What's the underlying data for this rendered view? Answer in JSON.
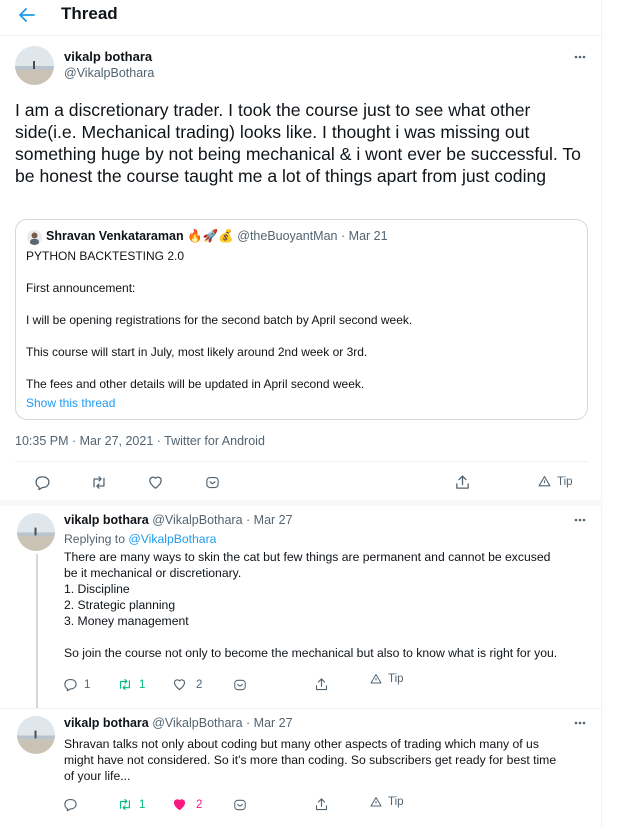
{
  "header": {
    "title": "Thread"
  },
  "main_tweet": {
    "author_name": "vikalp bothara",
    "author_handle": "@VikalpBothara",
    "text": "I am a discretionary trader. I took the course just to see what other side(i.e. Mechanical trading) looks like. I thought i was missing out something huge by not being mechanical & i wont ever be successful. To be honest the course taught me a lot of things apart from just coding",
    "quoted": {
      "author_name": "Shravan Venkataraman",
      "emojis": "🔥🚀💰",
      "handle": "@theBuoyantMan",
      "separator": "·",
      "date": "Mar 21",
      "lines": [
        "PYTHON BACKTESTING 2.0",
        "First announcement:",
        "I will be opening registrations for the second batch by April second week.",
        "This course will start in July, most likely around 2nd week or 3rd.",
        "The fees and other details will be updated in April second week."
      ],
      "show_thread": "Show this thread"
    },
    "meta": "10:35 PM · Mar 27, 2021 · Twitter for Android",
    "tip_label": "Tip"
  },
  "replies": [
    {
      "author_name": "vikalp bothara",
      "author_handle": "@VikalpBothara",
      "separator": "·",
      "date": "Mar 27",
      "replying_prefix": "Replying to",
      "replying_to": "@VikalpBothara",
      "lines": [
        "There are many ways to skin the cat but few things are permanent and cannot be excused",
        "be it mechanical or discretionary.",
        "1. Discipline",
        "2. Strategic planning",
        "3. Money management",
        "",
        "So join the course not only to become the mechanical but also to know what is right for you."
      ],
      "reply_count": "1",
      "retweet_count": "1",
      "like_count": "2",
      "tip_label": "Tip"
    },
    {
      "author_name": "vikalp bothara",
      "author_handle": "@VikalpBothara",
      "separator": "·",
      "date": "Mar 27",
      "lines": [
        "Shravan talks not only about coding but many other aspects of trading which many of us",
        "might have not considered. So it's more than coding. So subscribers get ready for best time",
        "of your life..."
      ],
      "retweet_count": "1",
      "like_count": "2",
      "tip_label": "Tip"
    }
  ],
  "colors": {
    "accent": "#1d9bf0",
    "text": "#0f1419",
    "muted": "#536471",
    "retweet_active": "#00ba7c",
    "like_active": "#f91880",
    "border": "#cfd9de"
  }
}
